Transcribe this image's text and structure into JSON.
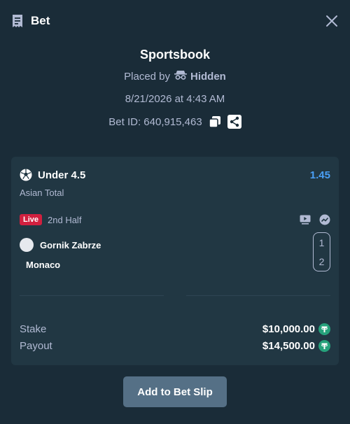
{
  "header": {
    "title": "Bet",
    "ticket_icon": "ticket-icon",
    "close_icon": "close-icon"
  },
  "info": {
    "provider": "Sportsbook",
    "placed_by_label": "Placed by",
    "placed_by_user": "Hidden",
    "date": "8/21/2026 at 4:43 AM",
    "bet_id": "Bet ID: 640,915,463"
  },
  "bet": {
    "outcome": "Under 4.5",
    "odds": "1.45",
    "market": "Asian Total",
    "live_label": "Live",
    "period": "2nd Half",
    "teams": [
      {
        "name": "Gornik Zabrze",
        "score": "1"
      },
      {
        "name": "Monaco",
        "score": "2"
      }
    ],
    "stake_label": "Stake",
    "stake_amount": "$10,000.00",
    "payout_label": "Payout",
    "payout_amount": "$14,500.00"
  },
  "colors": {
    "background": "#1a2c38",
    "card": "#213743",
    "accent_blue": "#4a9ff5",
    "live_red": "#d1203f",
    "tether_green": "#26a17b"
  },
  "actions": {
    "add_to_slip": "Add to Bet Slip"
  }
}
